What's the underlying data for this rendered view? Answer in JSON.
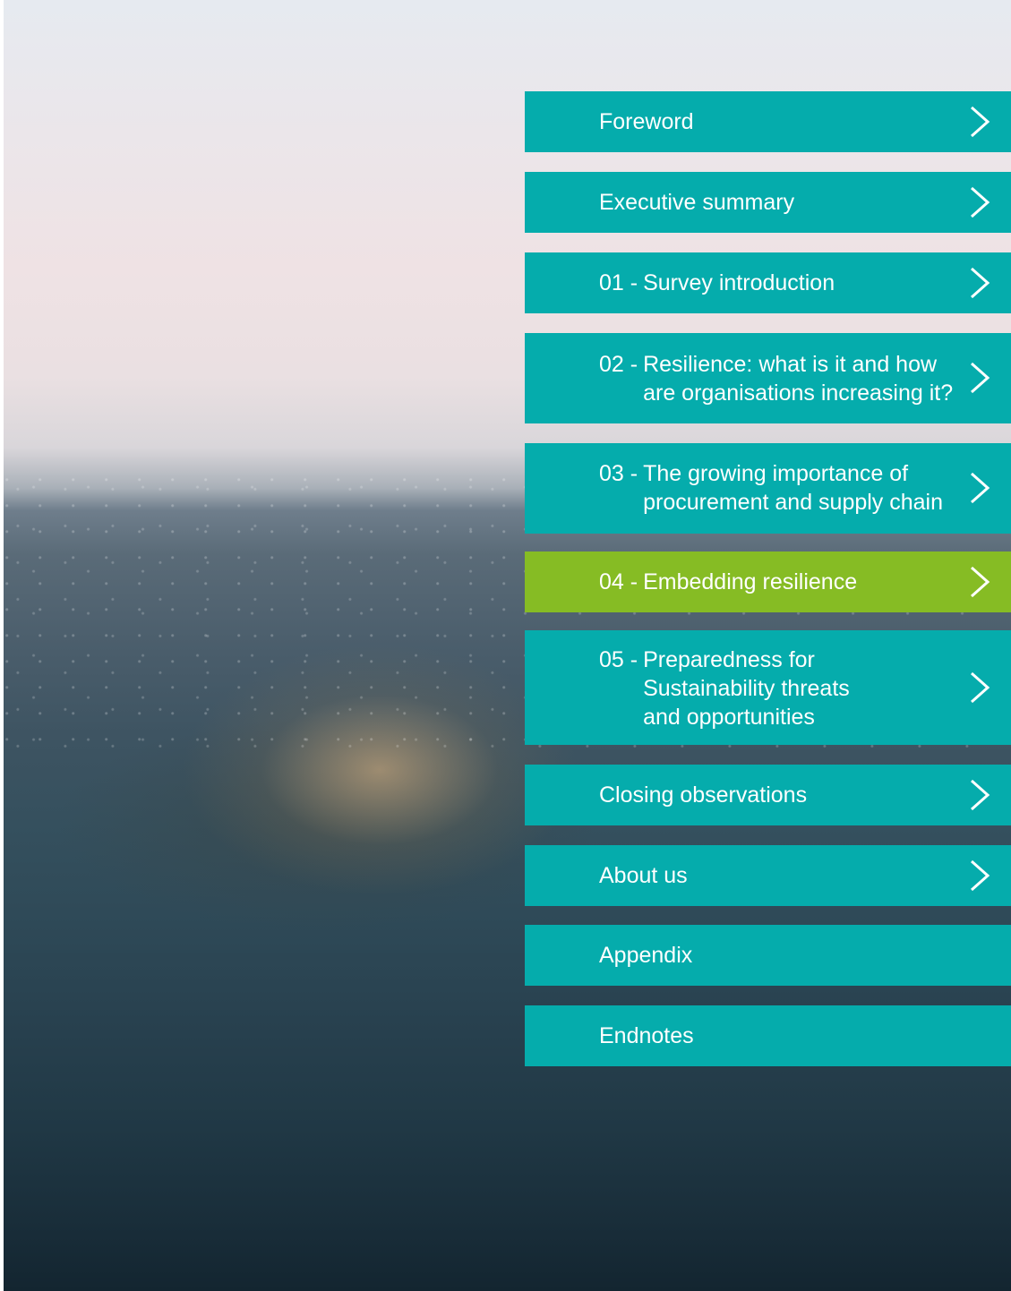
{
  "toc": {
    "items": [
      {
        "num": "",
        "label": "Foreword",
        "has_arrow": true
      },
      {
        "num": "",
        "label": "Executive summary",
        "has_arrow": true
      },
      {
        "num": "01 -",
        "label": "Survey introduction",
        "has_arrow": true
      },
      {
        "num": "02 -",
        "label": "Resilience: what is it and how\nare organisations increasing it?",
        "has_arrow": true
      },
      {
        "num": "03 -",
        "label": "The growing importance of\nprocurement and supply chain",
        "has_arrow": true
      },
      {
        "num": "04 -",
        "label": "Embedding resilience",
        "has_arrow": true,
        "active": true
      },
      {
        "num": "05 -",
        "label": "Preparedness for\nSustainability threats\nand opportunities",
        "has_arrow": true
      },
      {
        "num": "",
        "label": "Closing observations",
        "has_arrow": true
      },
      {
        "num": "",
        "label": "About us",
        "has_arrow": true
      },
      {
        "num": "",
        "label": "Appendix",
        "has_arrow": false
      },
      {
        "num": "",
        "label": "Endnotes",
        "has_arrow": false
      }
    ]
  },
  "icons": {
    "arrow": "chevron-right-icon"
  },
  "colors": {
    "teal": "#05acac",
    "active_green": "#86bc24",
    "text": "#ffffff"
  }
}
